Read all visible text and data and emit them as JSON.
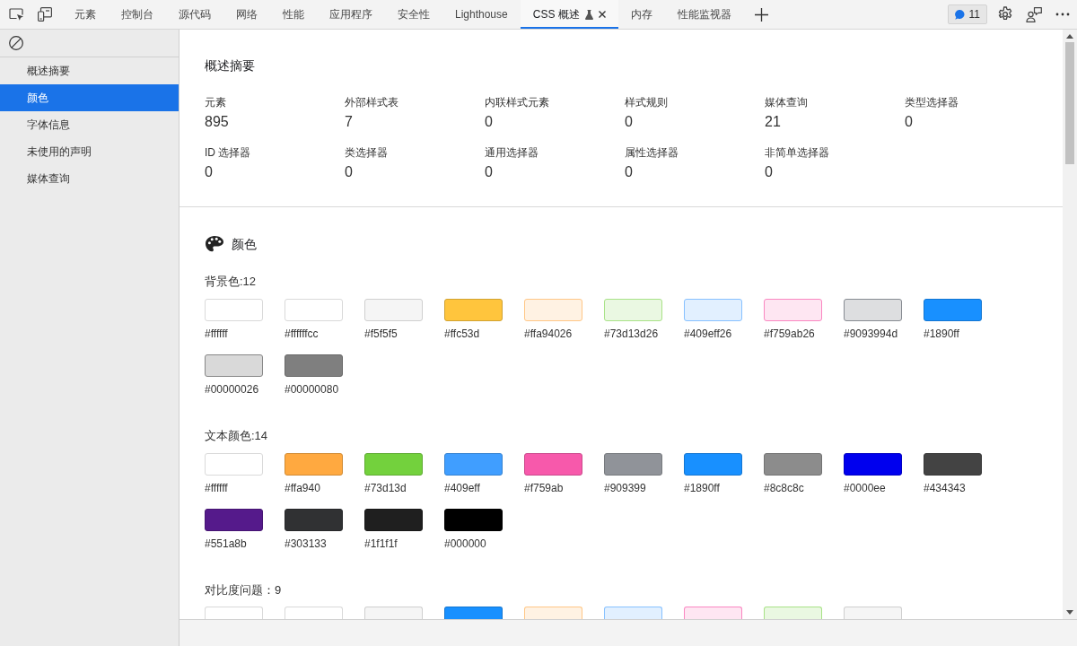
{
  "toolbar": {
    "tabs": [
      {
        "label": "元素",
        "selected": false,
        "experimental": false,
        "closable": false
      },
      {
        "label": "控制台",
        "selected": false,
        "experimental": false,
        "closable": false
      },
      {
        "label": "源代码",
        "selected": false,
        "experimental": false,
        "closable": false
      },
      {
        "label": "网络",
        "selected": false,
        "experimental": false,
        "closable": false
      },
      {
        "label": "性能",
        "selected": false,
        "experimental": false,
        "closable": false
      },
      {
        "label": "应用程序",
        "selected": false,
        "experimental": false,
        "closable": false
      },
      {
        "label": "安全性",
        "selected": false,
        "experimental": false,
        "closable": false
      },
      {
        "label": "Lighthouse",
        "selected": false,
        "experimental": false,
        "closable": false
      },
      {
        "label": "CSS 概述",
        "selected": true,
        "experimental": true,
        "closable": true
      },
      {
        "label": "内存",
        "selected": false,
        "experimental": false,
        "closable": false
      },
      {
        "label": "性能监视器",
        "selected": false,
        "experimental": false,
        "closable": false
      }
    ],
    "issues_count": "11"
  },
  "sidebar": {
    "items": [
      {
        "label": "概述摘要",
        "selected": false
      },
      {
        "label": "颜色",
        "selected": true
      },
      {
        "label": "字体信息",
        "selected": false
      },
      {
        "label": "未使用的声明",
        "selected": false
      },
      {
        "label": "媒体查询",
        "selected": false
      }
    ]
  },
  "overview": {
    "title": "概述摘要",
    "stats": [
      {
        "label": "元素",
        "value": "895"
      },
      {
        "label": "外部样式表",
        "value": "7"
      },
      {
        "label": "内联样式元素",
        "value": "0"
      },
      {
        "label": "样式规则",
        "value": "0"
      },
      {
        "label": "媒体查询",
        "value": "21"
      },
      {
        "label": "类型选择器",
        "value": "0"
      },
      {
        "label": "ID 选择器",
        "value": "0"
      },
      {
        "label": "类选择器",
        "value": "0"
      },
      {
        "label": "通用选择器",
        "value": "0"
      },
      {
        "label": "属性选择器",
        "value": "0"
      },
      {
        "label": "非简单选择器",
        "value": "0"
      }
    ]
  },
  "colors": {
    "title": "颜色",
    "groups": [
      {
        "kind": "swatches",
        "heading": "背景色:12",
        "swatches": [
          {
            "label": "#ffffff",
            "color": "#ffffff"
          },
          {
            "label": "#ffffffcc",
            "color": "#ffffff"
          },
          {
            "label": "#f5f5f5",
            "color": "#f5f5f5"
          },
          {
            "label": "#ffc53d",
            "color": "#ffc53d"
          },
          {
            "label": "#ffa94026",
            "color": "#fff2e3"
          },
          {
            "label": "#73d13d26",
            "color": "#eaf8e2"
          },
          {
            "label": "#409eff26",
            "color": "#e2f0ff"
          },
          {
            "label": "#f759ab26",
            "color": "#fee6f2"
          },
          {
            "label": "#9093994d",
            "color": "#dddee0"
          },
          {
            "label": "#1890ff",
            "color": "#1890ff"
          },
          {
            "label": "#00000026",
            "color": "#d9d9d9"
          },
          {
            "label": "#00000080",
            "color": "#7f7f7f"
          }
        ]
      },
      {
        "kind": "swatches",
        "heading": "文本颜色:14",
        "swatches": [
          {
            "label": "#ffffff",
            "color": "#ffffff"
          },
          {
            "label": "#ffa940",
            "color": "#ffa940"
          },
          {
            "label": "#73d13d",
            "color": "#73d13d"
          },
          {
            "label": "#409eff",
            "color": "#409eff"
          },
          {
            "label": "#f759ab",
            "color": "#f759ab"
          },
          {
            "label": "#909399",
            "color": "#909399"
          },
          {
            "label": "#1890ff",
            "color": "#1890ff"
          },
          {
            "label": "#8c8c8c",
            "color": "#8c8c8c"
          },
          {
            "label": "#0000ee",
            "color": "#0000ee"
          },
          {
            "label": "#434343",
            "color": "#434343"
          },
          {
            "label": "#551a8b",
            "color": "#551a8b"
          },
          {
            "label": "#303133",
            "color": "#303133"
          },
          {
            "label": "#1f1f1f",
            "color": "#1f1f1f"
          },
          {
            "label": "#000000",
            "color": "#000000"
          }
        ]
      },
      {
        "kind": "contrast",
        "heading": "对比度问题：9",
        "swatches": [
          {
            "color": "#ffffff"
          },
          {
            "color": "#ffffff"
          },
          {
            "color": "#f5f5f5"
          },
          {
            "color": "#1890ff"
          },
          {
            "color": "#fff2e3"
          },
          {
            "color": "#e2f0ff"
          },
          {
            "color": "#fee6f2"
          },
          {
            "color": "#eaf8e2"
          },
          {
            "color": "#f5f5f5"
          }
        ]
      }
    ]
  }
}
